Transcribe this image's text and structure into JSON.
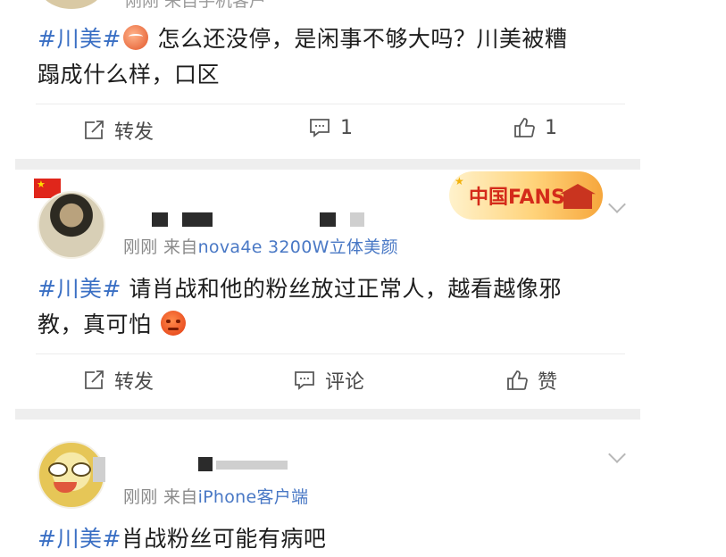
{
  "posts": [
    {
      "hashtag": "#川美#",
      "text": "怎么还没停，是闲事不够大吗？川美被糟",
      "text_line2": "蹋成什么样，口区",
      "meta_fragment": "刚刚 来自手机客户",
      "actions": {
        "repost": "转发",
        "comment": "1",
        "like": "1"
      }
    },
    {
      "time": "刚刚",
      "from": "来自",
      "source": "nova4e 3200W立体美颜",
      "badge": "中国FANS",
      "hashtag": "#川美#",
      "text": "请肖战和他的粉丝放过正常人，越看越像邪",
      "text_line2": "教，真可怕",
      "actions": {
        "repost": "转发",
        "comment": "评论",
        "like": "赞"
      }
    },
    {
      "time": "刚刚",
      "from": "来自",
      "source": "iPhone客户端",
      "hashtag": "#川美#",
      "text": "肖战粉丝可能有病吧"
    }
  ],
  "colors": {
    "hashtag": "#3a6fc4",
    "source_link": "#4978c5",
    "meta_gray": "#8a8a8a",
    "divider": "#eeeeee"
  },
  "icons": [
    "repost-icon",
    "comment-icon",
    "like-icon",
    "dropdown-chevron-icon",
    "shrimp-emoji",
    "angry-emoji"
  ]
}
